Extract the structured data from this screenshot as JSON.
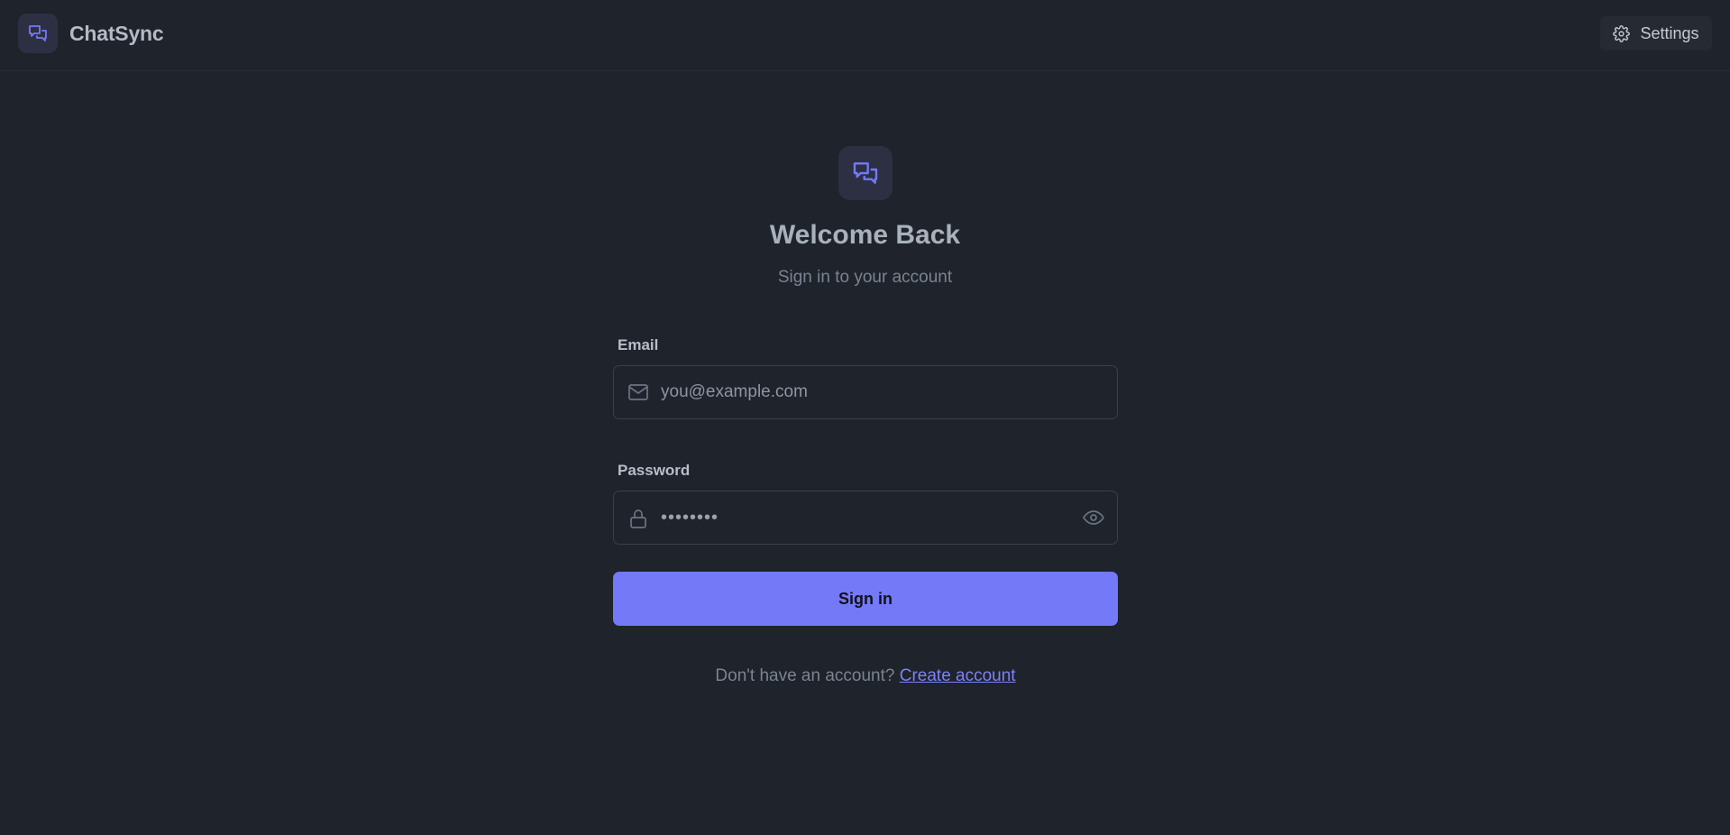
{
  "header": {
    "app_name": "ChatSync",
    "logo_icon": "chat-bubbles-icon",
    "settings_label": "Settings",
    "settings_icon": "gear-icon"
  },
  "hero": {
    "logo_icon": "chat-bubbles-icon",
    "title": "Welcome Back",
    "subtitle": "Sign in to your account"
  },
  "form": {
    "email": {
      "label": "Email",
      "placeholder": "you@example.com",
      "value": "",
      "icon": "mail-icon"
    },
    "password": {
      "label": "Password",
      "value": "••••••••",
      "icon": "lock-icon",
      "toggle_icon": "eye-icon"
    },
    "submit_label": "Sign in"
  },
  "footer": {
    "prompt": "Don't have an account?",
    "link_label": "Create account"
  },
  "colors": {
    "background": "#1f232b",
    "accent": "#7479f8",
    "link": "#7c82f8",
    "icon_badge": "#2c3042"
  }
}
